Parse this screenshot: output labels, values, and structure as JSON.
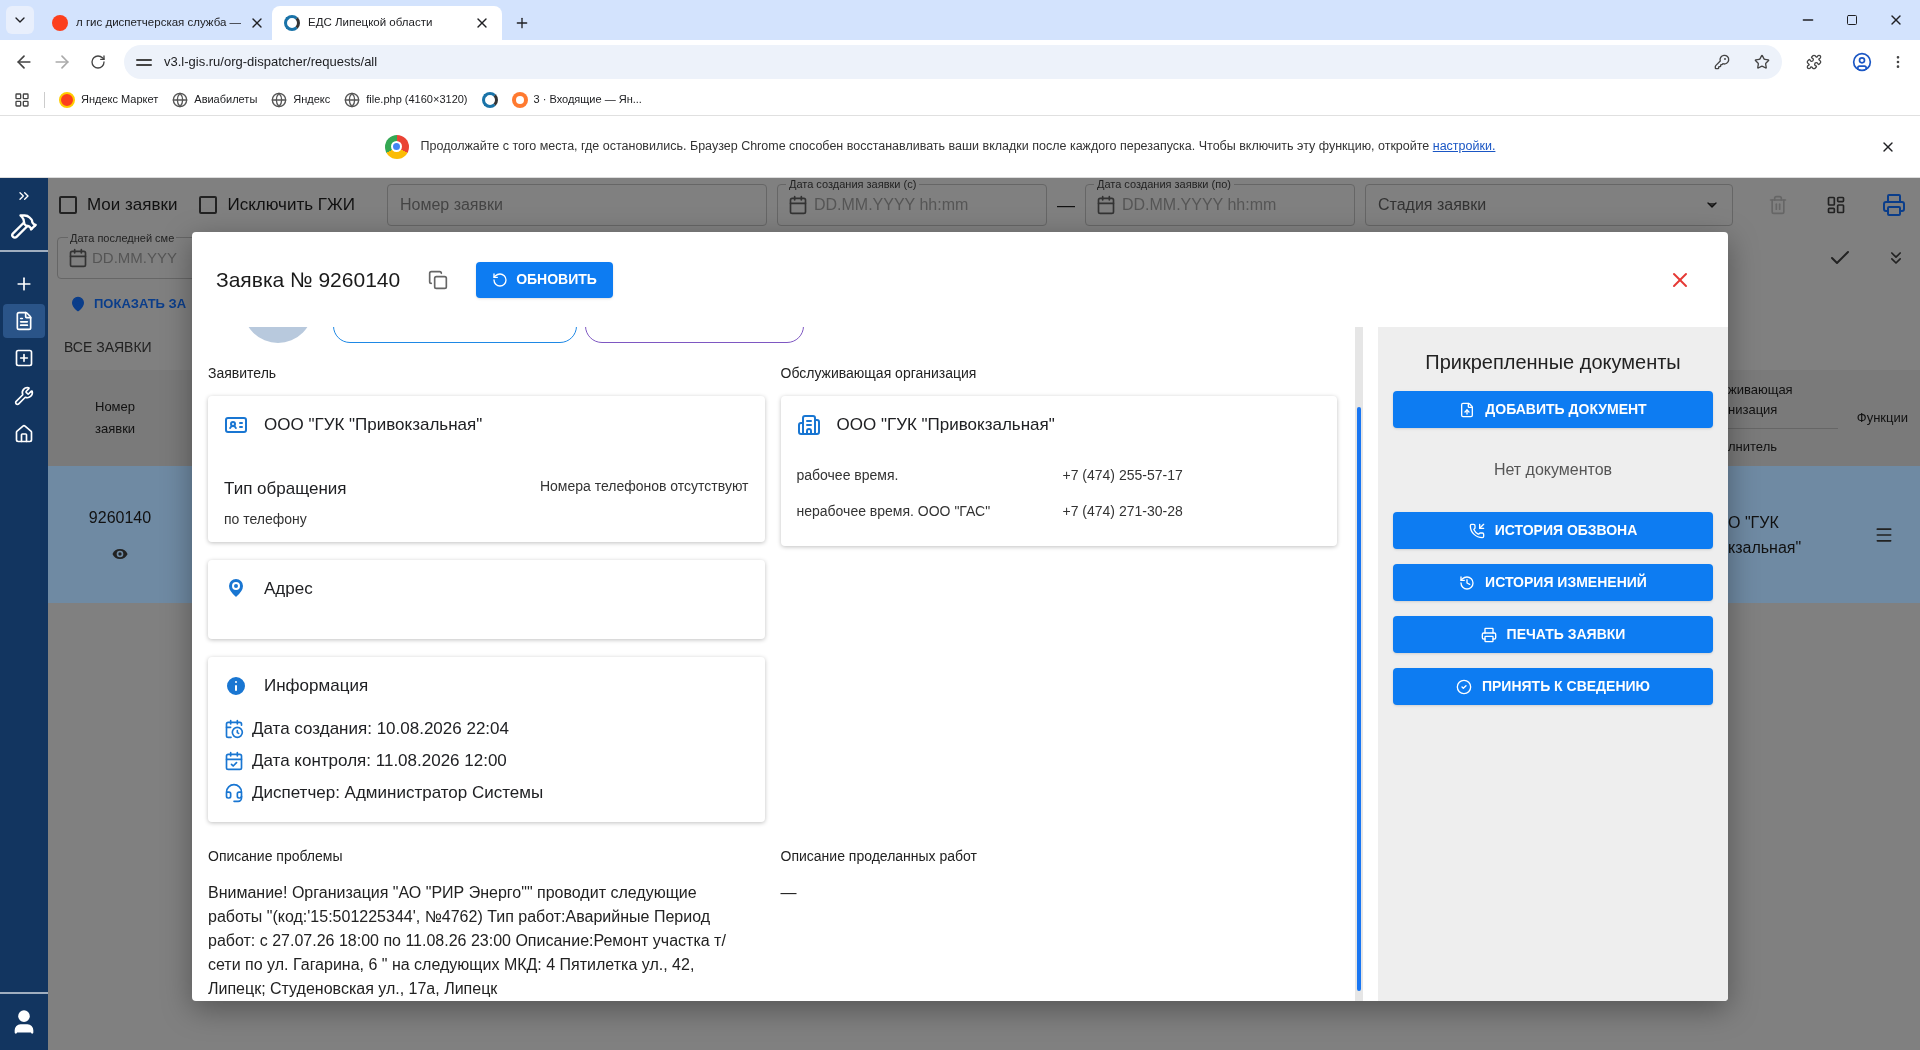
{
  "browser": {
    "tabs": [
      {
        "title": "л гис диспетчерская служба —",
        "kind": "search",
        "selected": false
      },
      {
        "title": "ЕДС Липецкой области",
        "kind": "site",
        "selected": true
      }
    ],
    "url": "v3.l-gis.ru/org-dispatcher/requests/all",
    "bookmarks": [
      {
        "kind": "market",
        "label": "Яндекс Маркет"
      },
      {
        "kind": "globe",
        "label": "Авиабилеты"
      },
      {
        "kind": "globe",
        "label": "Яндекс"
      },
      {
        "kind": "globe",
        "label": "file.php (4160×3120)"
      },
      {
        "kind": "site"
      },
      {
        "kind": "mail",
        "label": "3 · Входящие — Ян..."
      }
    ]
  },
  "restore_bar": {
    "message": "Продолжайте с того места, где остановились. Браузер Chrome способен восстанавливать ваши вкладки после каждого перезапуска. Чтобы включить эту функцию, откройте",
    "link": "настройки."
  },
  "app": {
    "filters": {
      "checkboxes": [
        {
          "label": "Мои заявки",
          "checked": false
        },
        {
          "label": "Исключить ГЖИ",
          "checked": false
        }
      ],
      "number_placeholder": "Номер заявки",
      "date_from": {
        "label": "Дата создания заявки (с)",
        "placeholder": "DD.MM.YYYY hh:mm"
      },
      "dash": "—",
      "date_to": {
        "label": "Дата создания заявки (по)",
        "placeholder": "DD.MM.YYYY hh:mm"
      },
      "stage_placeholder": "Стадия заявки",
      "last_change": {
        "label": "Дата последней сме",
        "placeholder": "DD.MM.YYY"
      }
    },
    "show_map": "ПОКАЗАТЬ ЗА",
    "tab": "ВСЕ ЗАЯВКИ",
    "column_number": "Номер заявки",
    "column_org": [
      "живающая",
      "низация"
    ],
    "column_executor": "лнитель",
    "column_functions": "Функции",
    "row": {
      "number": "9260140",
      "org": [
        "О \"ГУК",
        "кзальная\""
      ]
    }
  },
  "modal": {
    "title": "Заявка № 9260140",
    "refresh": "ОБНОВИТЬ",
    "applicant": {
      "heading": "Заявитель",
      "org": "ООО \"ГУК \"Привокзальная\"",
      "appeal_label": "Тип обращения",
      "appeal_value": "по телефону",
      "phones": "Номера телефонов отсутствуют"
    },
    "service_org": {
      "heading": "Обслуживающая организация",
      "org": "ООО \"ГУК \"Привокзальная\"",
      "contacts": [
        {
          "label": "рабочее время.",
          "phone": "+7 (474) 255-57-17"
        },
        {
          "label": "нерабочее время. ООО \"ГАС\"",
          "phone": "+7 (474) 271-30-28"
        }
      ]
    },
    "address": {
      "title": "Адрес"
    },
    "info": {
      "title": "Информация",
      "lines": [
        {
          "kind": "created",
          "text": "Дата создания: 10.08.2026 22:04"
        },
        {
          "kind": "control",
          "text": "Дата контроля: 11.08.2026 12:00"
        },
        {
          "kind": "dispatcher",
          "text": "Диспетчер: Администратор Системы"
        }
      ]
    },
    "problem": {
      "heading": "Описание проблемы",
      "text": "Внимание! Организация \"АО \"РИР Энерго\"\" проводит следующие работы \"(код:'15:501225344', №4762) Тип работ:Аварийные Период работ: с 27.07.26 18:00 по 11.08.26 23:00 Описание:Ремонт участка т/сети по ул. Гагарина, 6 \" на следующих МКД: 4 Пятилетка ул., 42, Липецк; Студеновская ул., 17а, Липецк"
    },
    "work": {
      "heading": "Описание проделанных работ",
      "text": "—"
    },
    "documents": {
      "title": "Прикрепленные документы",
      "add": "ДОБАВИТЬ ДОКУМЕНТ",
      "empty": "Нет документов",
      "actions": [
        {
          "kind": "calls",
          "label": "ИСТОРИЯ ОБЗВОНА"
        },
        {
          "kind": "history",
          "label": "ИСТОРИЯ ИЗМЕНЕНИЙ"
        },
        {
          "kind": "print",
          "label": "ПЕЧАТЬ ЗАЯВКИ"
        },
        {
          "kind": "accept",
          "label": "ПРИНЯТЬ К СВЕДЕНИЮ"
        }
      ]
    }
  }
}
